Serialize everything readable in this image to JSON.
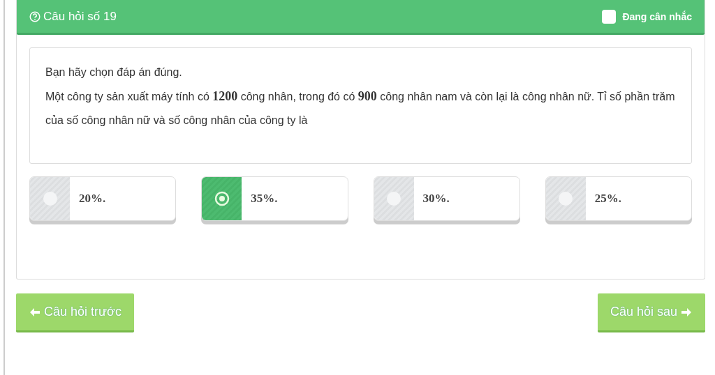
{
  "header": {
    "title": "Câu hỏi số 19",
    "flag": {
      "label": "Đang cân nhắc",
      "checked": false
    }
  },
  "question": {
    "instruction": "Bạn hãy chọn đáp án đúng.",
    "text": "Một công ty sản xuất máy tính có **1200** công nhân, trong đó có **900** công nhân nam và còn lại là công nhân nữ. Tỉ số phần trăm của số công nhân nữ và số công nhân của công ty là"
  },
  "options": [
    {
      "label": "20%.",
      "selected": false
    },
    {
      "label": "35%.",
      "selected": true
    },
    {
      "label": "30%.",
      "selected": false
    },
    {
      "label": "25%.",
      "selected": false
    }
  ],
  "nav": {
    "previous": "Câu hỏi trước",
    "next": "Câu hỏi sau"
  }
}
